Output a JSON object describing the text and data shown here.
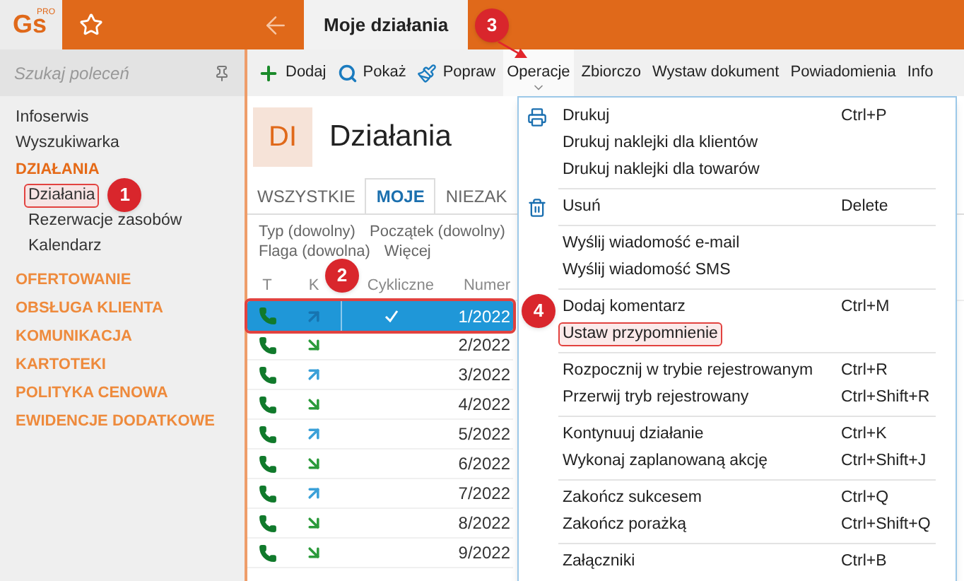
{
  "app": {
    "logo": "Gs",
    "logo_badge": "PRO",
    "tab": {
      "label": "Moje działania",
      "selected": true
    }
  },
  "sidebar": {
    "search_placeholder": "Szukaj poleceń",
    "items": [
      {
        "label": "Infoserwis",
        "kind": "link"
      },
      {
        "label": "Wyszukiwarka",
        "kind": "link"
      },
      {
        "label": "DZIAŁANIA",
        "kind": "section",
        "expanded": true,
        "children": [
          {
            "label": "Działania",
            "selected": true
          },
          {
            "label": "Rezerwacje zasobów",
            "selected": false
          },
          {
            "label": "Kalendarz",
            "selected": false
          }
        ]
      },
      {
        "label": "OFERTOWANIE",
        "kind": "section",
        "expanded": false
      },
      {
        "label": "OBSŁUGA KLIENTA",
        "kind": "section",
        "expanded": false
      },
      {
        "label": "KOMUNIKACJA",
        "kind": "section",
        "expanded": false
      },
      {
        "label": "KARTOTEKI",
        "kind": "section",
        "expanded": false
      },
      {
        "label": "POLITYKA CENOWA",
        "kind": "section",
        "expanded": false
      },
      {
        "label": "EWIDENCJE DODATKOWE",
        "kind": "section",
        "expanded": false
      }
    ]
  },
  "toolbar": [
    {
      "label": "Dodaj",
      "kind": "add"
    },
    {
      "label": "Pokaż",
      "kind": "search"
    },
    {
      "label": "Popraw",
      "kind": "edit"
    },
    {
      "label": "Operacje",
      "kind": "menu"
    },
    {
      "label": "Zbiorczo",
      "kind": "text"
    },
    {
      "label": "Wystaw dokument",
      "kind": "text"
    },
    {
      "label": "Powiadomienia",
      "kind": "text"
    },
    {
      "label": "Info",
      "kind": "text"
    }
  ],
  "header": {
    "badge": "DI",
    "title": "Działania"
  },
  "tabs": [
    {
      "label": "WSZYSTKIE",
      "selected": false
    },
    {
      "label": "MOJE",
      "selected": true
    },
    {
      "label": "NIEZAK",
      "selected": false
    }
  ],
  "filters": [
    [
      "Typ (dowolny)",
      "Początek (dowolny)"
    ],
    [
      "Flaga (dowolna)",
      "Więcej"
    ]
  ],
  "table": {
    "columns": [
      "T",
      "K",
      "Cykliczne",
      "Numer"
    ],
    "rows": [
      {
        "kind": "outgoing",
        "recurring": true,
        "number": "1/2022",
        "selected": true
      },
      {
        "kind": "incoming",
        "recurring": false,
        "number": "2/2022",
        "selected": false
      },
      {
        "kind": "outgoing",
        "recurring": false,
        "number": "3/2022",
        "selected": false
      },
      {
        "kind": "incoming",
        "recurring": false,
        "number": "4/2022",
        "selected": false
      },
      {
        "kind": "outgoing",
        "recurring": false,
        "number": "5/2022",
        "selected": false
      },
      {
        "kind": "incoming",
        "recurring": false,
        "number": "6/2022",
        "selected": false
      },
      {
        "kind": "outgoing",
        "recurring": false,
        "number": "7/2022",
        "selected": false
      },
      {
        "kind": "incoming",
        "recurring": false,
        "number": "8/2022",
        "selected": false
      },
      {
        "kind": "incoming",
        "recurring": false,
        "number": "9/2022",
        "selected": false
      }
    ]
  },
  "menu": {
    "groups": [
      [
        {
          "label": "Drukuj",
          "shortcut": "Ctrl+P",
          "kind": "print",
          "highlighted": false
        },
        {
          "label": "Drukuj naklejki dla klientów",
          "highlighted": false
        },
        {
          "label": "Drukuj naklejki dla towarów",
          "highlighted": false
        }
      ],
      [
        {
          "label": "Usuń",
          "shortcut": "Delete",
          "kind": "delete",
          "highlighted": false
        }
      ],
      [
        {
          "label": "Wyślij wiadomość e-mail",
          "highlighted": false
        },
        {
          "label": "Wyślij wiadomość SMS",
          "highlighted": false
        }
      ],
      [
        {
          "label": "Dodaj komentarz",
          "shortcut": "Ctrl+M",
          "highlighted": false
        },
        {
          "label": "Ustaw przypomnienie",
          "highlighted": true
        }
      ],
      [
        {
          "label": "Rozpocznij w trybie rejestrowanym",
          "shortcut": "Ctrl+R",
          "highlighted": false
        },
        {
          "label": "Przerwij tryb rejestrowany",
          "shortcut": "Ctrl+Shift+R",
          "highlighted": false
        }
      ],
      [
        {
          "label": "Kontynuuj działanie",
          "shortcut": "Ctrl+K",
          "highlighted": false
        },
        {
          "label": "Wykonaj zaplanowaną akcję",
          "shortcut": "Ctrl+Shift+J",
          "highlighted": false
        }
      ],
      [
        {
          "label": "Zakończ sukcesem",
          "shortcut": "Ctrl+Q",
          "highlighted": false
        },
        {
          "label": "Zakończ porażką",
          "shortcut": "Ctrl+Shift+Q",
          "highlighted": false
        }
      ],
      [
        {
          "label": "Załączniki",
          "shortcut": "Ctrl+B",
          "highlighted": false
        }
      ]
    ]
  },
  "annotations": [
    "1",
    "2",
    "3",
    "4"
  ]
}
